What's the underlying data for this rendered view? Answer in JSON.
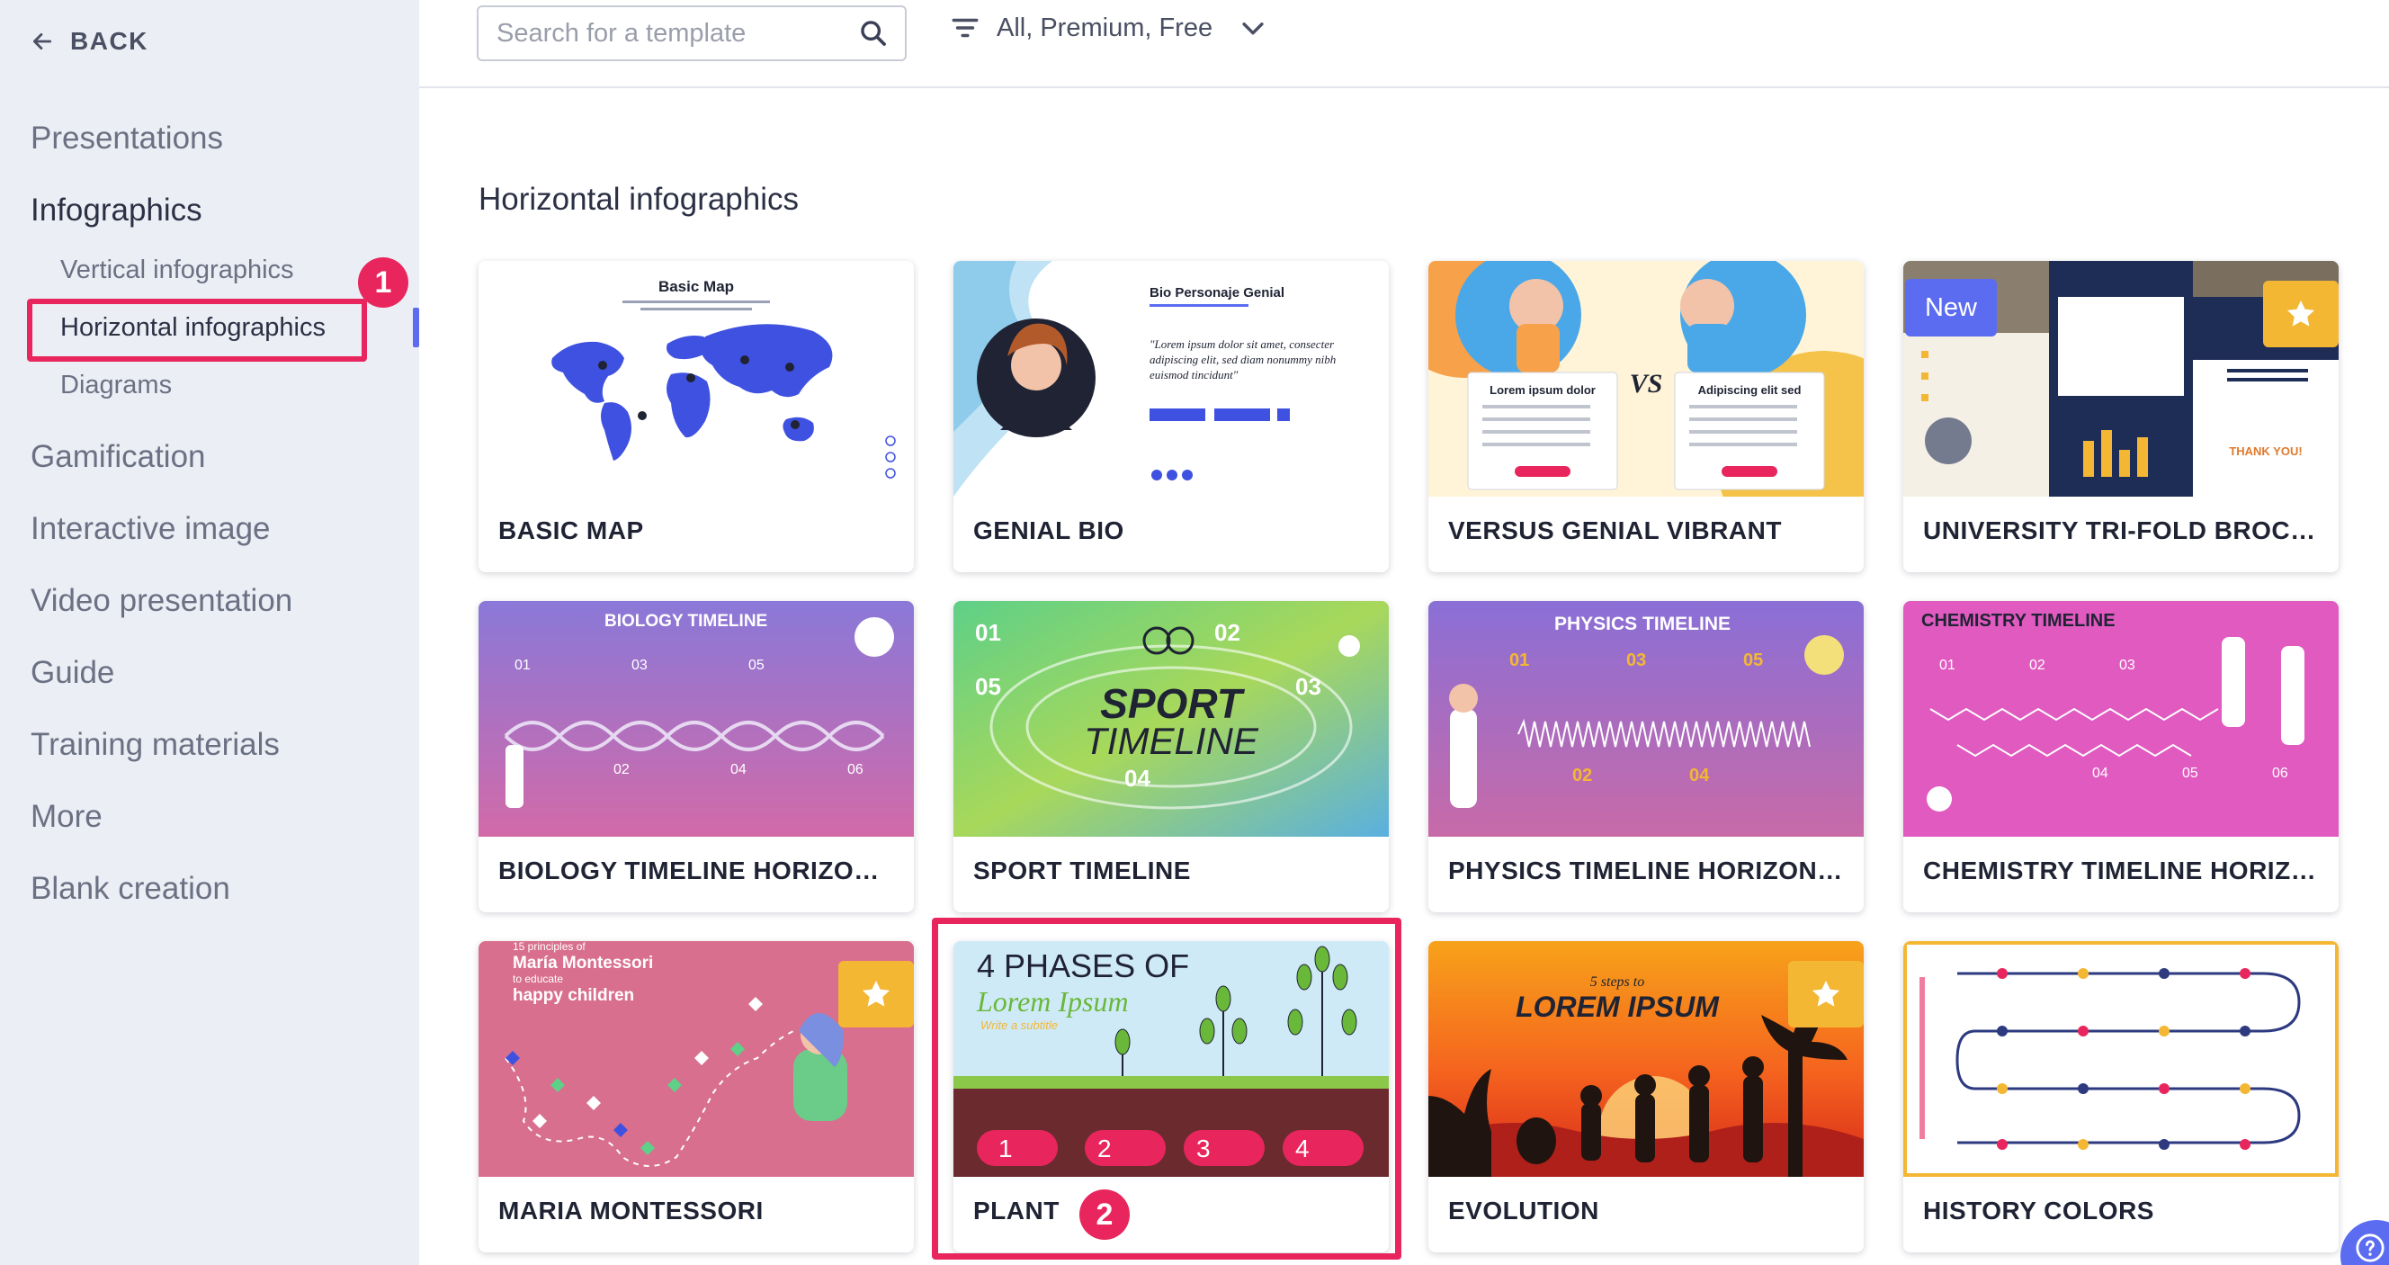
{
  "sidebar": {
    "back_label": "BACK",
    "items": [
      {
        "label": "Presentations"
      },
      {
        "label": "Infographics"
      },
      {
        "label": "Gamification"
      },
      {
        "label": "Interactive image"
      },
      {
        "label": "Video presentation"
      },
      {
        "label": "Guide"
      },
      {
        "label": "Training materials"
      },
      {
        "label": "More"
      },
      {
        "label": "Blank creation"
      }
    ],
    "sub_items": [
      {
        "label": "Vertical infographics"
      },
      {
        "label": "Horizontal infographics"
      },
      {
        "label": "Diagrams"
      }
    ],
    "step_badge": "1"
  },
  "search": {
    "placeholder": "Search for a template"
  },
  "filter": {
    "label": "All, Premium, Free"
  },
  "main": {
    "section_title": "Horizontal infographics",
    "step_badge": "2",
    "cards": [
      {
        "title": "BASIC MAP",
        "thumb_title": "Basic Map"
      },
      {
        "title": "GENIAL BIO",
        "thumb_title": "Bio Personaje Genial",
        "thumb_quote": "\"Lorem ipsum dolor sit amet, consecter adipiscing elit, sed diam nonummy nibh euismod tincidunt\""
      },
      {
        "title": "VERSUS GENIAL VIBRANT",
        "thumb_vs": "VS",
        "thumb_left": "Lorem ipsum dolor",
        "thumb_right": "Adipiscing elit sed"
      },
      {
        "title": "UNIVERSITY TRI-FOLD BROCHURE",
        "badge": "New",
        "thumb_cta": "THANK YOU!"
      },
      {
        "title": "BIOLOGY TIMELINE HORIZONTAL",
        "thumb_title": "BIOLOGY TIMELINE"
      },
      {
        "title": "SPORT TIMELINE",
        "thumb_title_1": "SPORT",
        "thumb_title_2": "TIMELINE"
      },
      {
        "title": "PHYSICS TIMELINE HORIZONTAL",
        "thumb_title": "PHYSICS TIMELINE"
      },
      {
        "title": "CHEMISTRY TIMELINE HORIZONTAL",
        "thumb_title": "CHEMISTRY TIMELINE"
      },
      {
        "title": "MARIA MONTESSORI",
        "thumb_line1": "15 principles of",
        "thumb_line2": "María Montessori",
        "thumb_line3": "to educate",
        "thumb_line4": "happy children"
      },
      {
        "title": "PLANT",
        "thumb_title": "4 PHASES OF",
        "thumb_subtitle": "Lorem Ipsum",
        "thumb_tag": "Write a subtitle"
      },
      {
        "title": "EVOLUTION",
        "thumb_small": "5 steps to",
        "thumb_title": "LOREM IPSUM"
      },
      {
        "title": "HISTORY COLORS"
      }
    ]
  },
  "colors": {
    "accent": "#5b6cf0",
    "highlight": "#e8265d",
    "star": "#f3b734",
    "sidebar_bg": "#eceef5"
  },
  "icons": [
    "arrow-left-icon",
    "search-icon",
    "filter-icon",
    "chevron-down-icon",
    "star-icon",
    "help-icon"
  ]
}
